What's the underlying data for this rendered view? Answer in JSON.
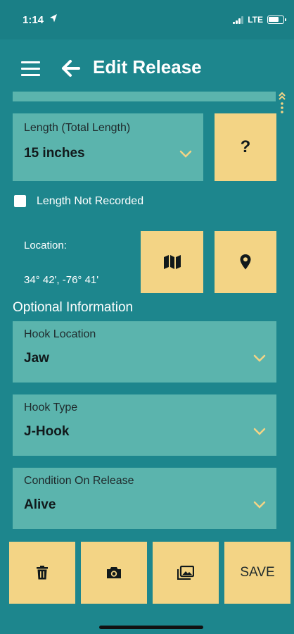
{
  "status_bar": {
    "time": "1:14",
    "network": "LTE"
  },
  "header": {
    "title": "Edit Release"
  },
  "length": {
    "label": "Length (Total Length)",
    "value": "15 inches",
    "help_label": "?"
  },
  "length_not_recorded": {
    "label": "Length Not Recorded",
    "checked": false
  },
  "location": {
    "label": "Location:",
    "value": "34° 42', -76° 41'"
  },
  "optional": {
    "heading": "Optional Information"
  },
  "hook_location": {
    "label": "Hook Location",
    "value": "Jaw"
  },
  "hook_type": {
    "label": "Hook Type",
    "value": "J-Hook"
  },
  "condition": {
    "label": "Condition On Release",
    "value": "Alive"
  },
  "actions": {
    "save_label": "SAVE"
  },
  "colors": {
    "background": "#1d868d",
    "card": "#5bb4ad",
    "button": "#f3d485",
    "chevron": "#f3d485"
  }
}
